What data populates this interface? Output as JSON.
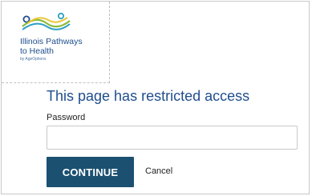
{
  "brand": {
    "name_line1": "Illinois Pathways",
    "name_line2": "to Health",
    "subtitle": "by AgeOptions",
    "colors": {
      "blue": "#1f4e8c",
      "green": "#8dbb3c",
      "teal": "#2d9fc6",
      "yellow": "#e9c83a"
    }
  },
  "page": {
    "heading": "This page has restricted access",
    "password_label": "Password",
    "password_value": "",
    "password_placeholder": ""
  },
  "actions": {
    "continue_label": "CONTINUE",
    "cancel_label": "Cancel",
    "continue_color": "#1b5071"
  }
}
